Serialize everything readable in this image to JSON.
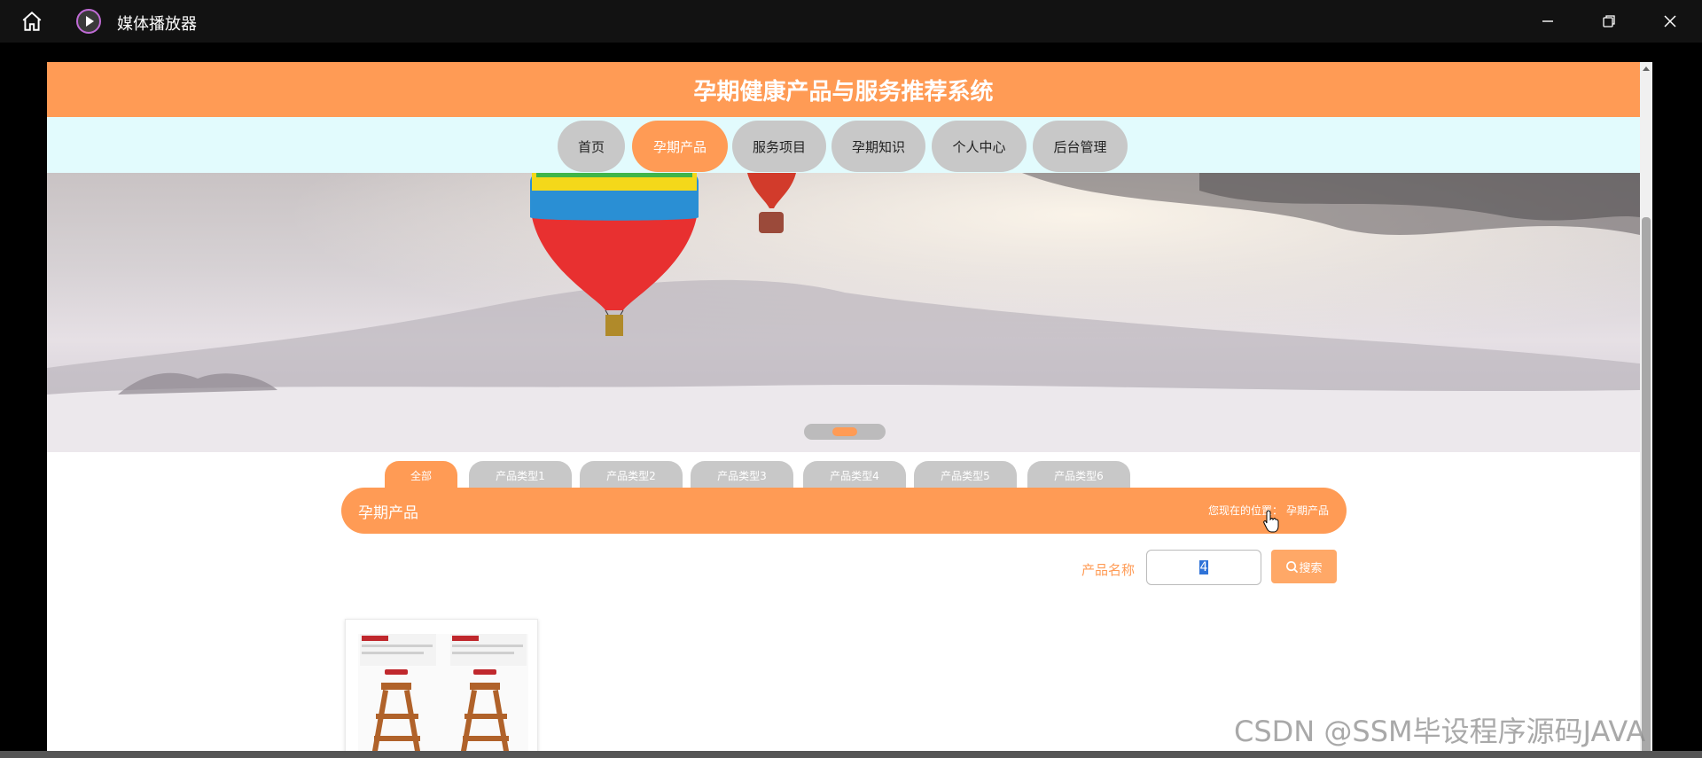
{
  "window": {
    "title": "媒体播放器",
    "home_icon": "home-icon",
    "app_icon": "media-player-icon",
    "controls": [
      "minimize-icon",
      "restore-icon",
      "close-icon"
    ]
  },
  "site": {
    "title": "孕期健康产品与服务推荐系统"
  },
  "nav": {
    "items": [
      "首页",
      "孕期产品",
      "服务项目",
      "孕期知识",
      "个人中心",
      "后台管理"
    ],
    "active": "孕期产品"
  },
  "categories": {
    "items": [
      "全部",
      "产品类型1",
      "产品类型2",
      "产品类型3",
      "产品类型4",
      "产品类型5",
      "产品类型6"
    ],
    "active": "全部"
  },
  "section": {
    "title": "孕期产品",
    "breadcrumb_prefix": "您现在的位置：",
    "breadcrumb_current": "孕期产品"
  },
  "search": {
    "label": "产品名称",
    "value": "4",
    "button_label": "搜索"
  },
  "colors": {
    "accent": "#ff9b55",
    "nav_bg": "#e2fbfd",
    "inactive": "#c8c8c8"
  },
  "watermark": "CSDN @SSM毕设程序源码JAVA"
}
